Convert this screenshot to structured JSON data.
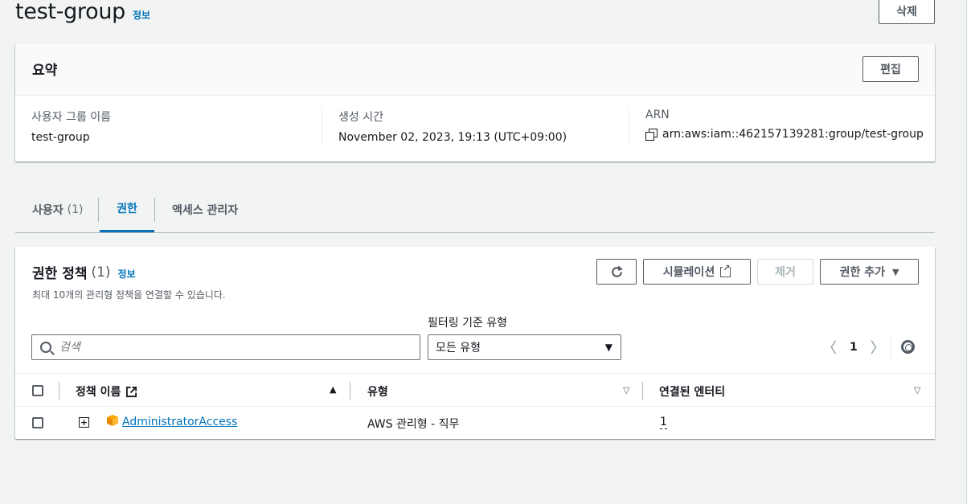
{
  "header": {
    "title": "test-group",
    "info": "정보",
    "delete_label": "삭제"
  },
  "summary": {
    "title": "요약",
    "edit_label": "편집",
    "fields": [
      {
        "label": "사용자 그룹 이름",
        "value": "test-group"
      },
      {
        "label": "생성 시간",
        "value": "November 02, 2023, 19:13 (UTC+09:00)"
      },
      {
        "label": "ARN",
        "value": "arn:aws:iam::462157139281:group/test-group"
      }
    ]
  },
  "tabs": [
    {
      "label": "사용자",
      "count": "(1)"
    },
    {
      "label": "권한"
    },
    {
      "label": "액세스 관리자"
    }
  ],
  "policies": {
    "title": "권한 정책",
    "count": "(1)",
    "info": "정보",
    "description": "최대 10개의 관리형 정책을 연결할 수 있습니다.",
    "simulate_label": "시뮬레이션",
    "remove_label": "제거",
    "add_label": "권한 추가",
    "search_placeholder": "검색",
    "filter_label": "필터링 기준 유형",
    "filter_value": "모든 유형",
    "page": "1",
    "columns": [
      "정책 이름",
      "유형",
      "연결된 엔터티"
    ],
    "rows": [
      {
        "name": "AdministratorAccess",
        "type": "AWS 관리형 - 직무",
        "attached": "1"
      }
    ]
  },
  "colors": {
    "link": "#0073bb",
    "text": "#16191f",
    "background": "#f2f3f3"
  }
}
